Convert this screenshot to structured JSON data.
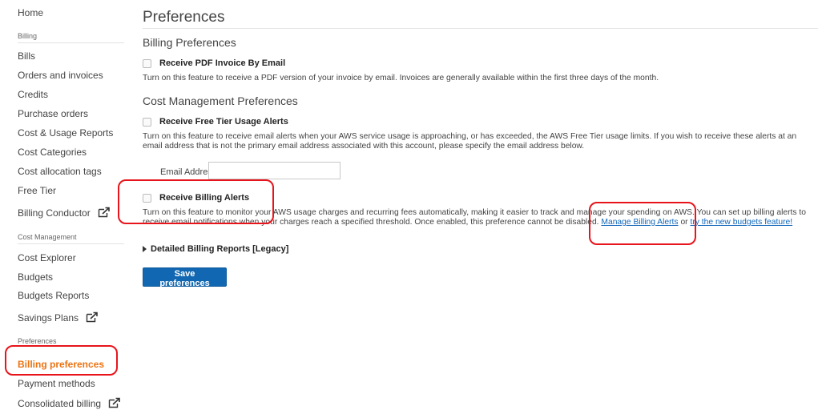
{
  "sidebar": {
    "home": "Home",
    "billing_section": "Billing",
    "billing_items": [
      "Bills",
      "Orders and invoices",
      "Credits",
      "Purchase orders",
      "Cost & Usage Reports",
      "Cost Categories",
      "Cost allocation tags",
      "Free Tier",
      "Billing Conductor"
    ],
    "cost_management_section": "Cost Management",
    "cost_items": [
      "Cost Explorer",
      "Budgets",
      "Budgets Reports",
      "Savings Plans"
    ],
    "preferences_section": "Preferences",
    "preference_items": [
      "Billing preferences",
      "Payment methods",
      "Consolidated billing"
    ],
    "active_item": "Billing preferences"
  },
  "main": {
    "title": "Preferences",
    "billing_preferences": {
      "heading": "Billing Preferences",
      "pdf_invoice": {
        "label": "Receive PDF Invoice By Email",
        "checked": false,
        "description": "Turn on this feature to receive a PDF version of your invoice by email. Invoices are generally available within the first three days of the month."
      }
    },
    "cost_management_preferences": {
      "heading": "Cost Management Preferences",
      "free_tier_alerts": {
        "label": "Receive Free Tier Usage Alerts",
        "checked": false,
        "description": "Turn on this feature to receive email alerts when your AWS service usage is approaching, or has exceeded, the AWS Free Tier usage limits. If you wish to receive these alerts at an email address that is not the primary email address associated with this account, please specify the email address below."
      },
      "email_address": {
        "label": "Email Address:",
        "value": "",
        "placeholder": ""
      },
      "billing_alerts": {
        "label": "Receive Billing Alerts",
        "checked": false,
        "description_line1": "Turn on this feature to monitor your AWS usage charges and recurring fees automatically, making it easier to track and manage your spending on AWS. You can set up billing alerts to",
        "description_line2": "receive email notifications when your charges reach a specified threshold. Once enabled, this preference cannot be disabled.",
        "manage_link": "Manage Billing Alerts",
        "or_text": "or",
        "budgets_link": "try the new budgets feature!"
      }
    },
    "detailed_billing_reports": {
      "label": "Detailed Billing Reports [Legacy]",
      "expanded": false
    },
    "save_button": "Save preferences"
  },
  "colors": {
    "active_nav": "#ec7211",
    "link": "#1166bb",
    "primary_button": "#1167b1",
    "annotation": "#e8141c"
  }
}
